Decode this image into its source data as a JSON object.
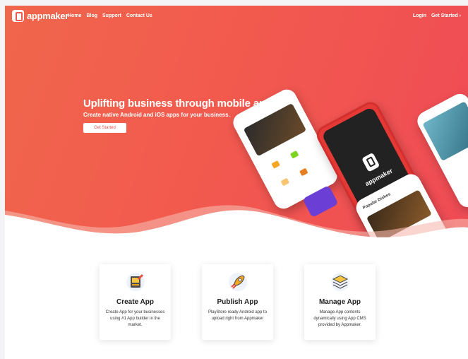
{
  "nav": {
    "logo_text": "appmaker",
    "links": [
      "Home",
      "Blog",
      "Support",
      "Contact Us"
    ],
    "login": "Login",
    "get_started": "Get Started ›"
  },
  "hero": {
    "headline": "Uplifting business through mobile apps",
    "subheadline": "Create native Android and iOS apps for your business.",
    "cta": "Get Started"
  },
  "mockups": {
    "center_brand": "appmaker",
    "popular_title": "Popular Dishes"
  },
  "features": [
    {
      "title": "Create App",
      "desc": "Create App for your businesses using #1 App builder in the market.",
      "icon": "design-icon"
    },
    {
      "title": "Publish App",
      "desc": "PlayStore ready Android app to upload right from Appmaker",
      "icon": "rocket-icon"
    },
    {
      "title": "Manage App",
      "desc": "Manage App contents dynamically using App CMS provided by Appmaker.",
      "icon": "layers-icon"
    }
  ],
  "colors": {
    "brand": "#f0584f",
    "hero_start": "#f0664c",
    "hero_end": "#ef4b55"
  }
}
